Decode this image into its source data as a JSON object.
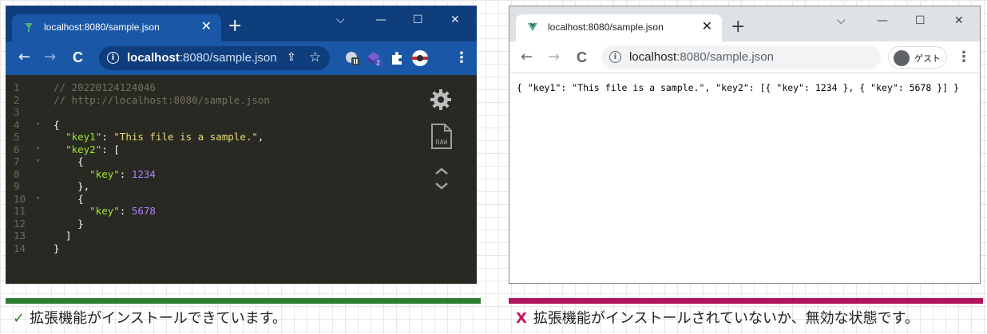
{
  "left_browser": {
    "tab_title": "localhost:8080/sample.json",
    "tab_close": "✕",
    "new_tab": "+",
    "window_controls": {
      "dropdown": "⌵",
      "minimize": "—",
      "maximize": "☐",
      "close": "✕"
    },
    "nav": {
      "back": "←",
      "forward": "→",
      "reload": "C"
    },
    "address": {
      "host": "localhost",
      "rest": ":8080/sample.json",
      "info": "i"
    },
    "extension_badge": "2",
    "editor_lines": [
      {
        "n": "1",
        "fold": "",
        "segs": [
          {
            "c": "c-comment",
            "t": "// 20220124124046"
          }
        ]
      },
      {
        "n": "2",
        "fold": "",
        "segs": [
          {
            "c": "c-comment",
            "t": "// http://localhost:8080/sample.json"
          }
        ]
      },
      {
        "n": "3",
        "fold": "",
        "segs": []
      },
      {
        "n": "4",
        "fold": "▾",
        "segs": [
          {
            "c": "c-brace",
            "t": "{"
          }
        ]
      },
      {
        "n": "5",
        "fold": "",
        "segs": [
          {
            "c": "c-brace",
            "t": "  "
          },
          {
            "c": "c-key",
            "t": "\"key1\""
          },
          {
            "c": "c-brace",
            "t": ": "
          },
          {
            "c": "c-str",
            "t": "\"This file is a sample.\""
          },
          {
            "c": "c-brace",
            "t": ","
          }
        ]
      },
      {
        "n": "6",
        "fold": "▾",
        "segs": [
          {
            "c": "c-brace",
            "t": "  "
          },
          {
            "c": "c-key",
            "t": "\"key2\""
          },
          {
            "c": "c-brace",
            "t": ": ["
          }
        ]
      },
      {
        "n": "7",
        "fold": "▾",
        "segs": [
          {
            "c": "c-brace",
            "t": "    {"
          }
        ]
      },
      {
        "n": "8",
        "fold": "",
        "segs": [
          {
            "c": "c-brace",
            "t": "      "
          },
          {
            "c": "c-key",
            "t": "\"key\""
          },
          {
            "c": "c-brace",
            "t": ": "
          },
          {
            "c": "c-num",
            "t": "1234"
          }
        ]
      },
      {
        "n": "9",
        "fold": "",
        "segs": [
          {
            "c": "c-brace",
            "t": "    },"
          }
        ]
      },
      {
        "n": "10",
        "fold": "▾",
        "segs": [
          {
            "c": "c-brace",
            "t": "    {"
          }
        ]
      },
      {
        "n": "11",
        "fold": "",
        "segs": [
          {
            "c": "c-brace",
            "t": "      "
          },
          {
            "c": "c-key",
            "t": "\"key\""
          },
          {
            "c": "c-brace",
            "t": ": "
          },
          {
            "c": "c-num",
            "t": "5678"
          }
        ]
      },
      {
        "n": "12",
        "fold": "",
        "segs": [
          {
            "c": "c-brace",
            "t": "    }"
          }
        ]
      },
      {
        "n": "13",
        "fold": "",
        "segs": [
          {
            "c": "c-brace",
            "t": "  ]"
          }
        ]
      },
      {
        "n": "14",
        "fold": "",
        "segs": [
          {
            "c": "c-brace",
            "t": "}"
          }
        ]
      }
    ],
    "raw_label": "RAW",
    "colors": {
      "titlebar": "#0f3e7d",
      "toolbar": "#1a57a7",
      "editor_bg": "#282923"
    }
  },
  "right_browser": {
    "tab_title": "localhost:8080/sample.json",
    "tab_close": "✕",
    "new_tab": "+",
    "window_controls": {
      "dropdown": "⌵",
      "minimize": "—",
      "maximize": "☐",
      "close": "✕"
    },
    "nav": {
      "back": "←",
      "forward": "→",
      "reload": "C"
    },
    "address": {
      "host": "localhost",
      "rest": ":8080/sample.json",
      "info": "i"
    },
    "guest_label": "ゲスト",
    "raw_json": "{ \"key1\": \"This file is a sample.\", \"key2\": [{ \"key\": 1234 }, { \"key\": 5678 }] }",
    "colors": {
      "titlebar": "#dee1e6",
      "toolbar": "#ffffff"
    }
  },
  "captions": {
    "installed_mark": "✓",
    "installed": "拡張機能がインストールできています。",
    "not_installed_mark": "X",
    "not_installed": "拡張機能がインストールされていないか、無効な状態です。"
  },
  "status_colors": {
    "ok": "#2e7d32",
    "ng": "#b0145c"
  }
}
